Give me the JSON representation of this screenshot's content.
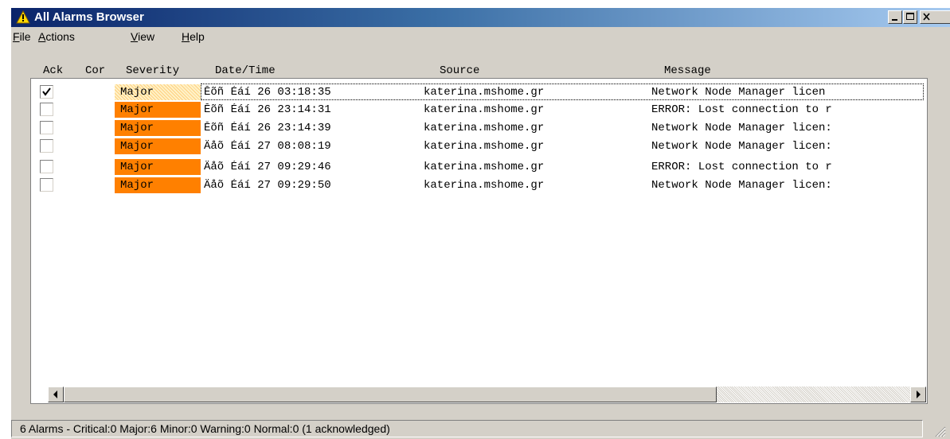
{
  "window": {
    "title": "All Alarms Browser",
    "title_icon": "warning-triangle-icon",
    "controls": [
      "minimize-icon",
      "maximize-icon",
      "close-icon"
    ]
  },
  "menu": {
    "file": {
      "u": "F",
      "rest": "ile"
    },
    "actions": {
      "u": "A",
      "rest": "ctions"
    },
    "view": {
      "u": "V",
      "rest": "iew"
    },
    "help": {
      "u": "H",
      "rest": "elp"
    }
  },
  "table": {
    "headers": {
      "ack": "Ack",
      "cor": "Cor",
      "severity": "Severity",
      "datetime": "Date/Time",
      "source": "Source",
      "message": "Message"
    },
    "rows": [
      {
        "ack": true,
        "severity": "Major",
        "datetime": "Ĕõñ Éáí 26 03:18:35",
        "source": "katerina.mshome.gr",
        "message": "Network Node Manager licen"
      },
      {
        "ack": false,
        "severity": "Major",
        "datetime": "Ĕõñ Éáí 26 23:14:31",
        "source": "katerina.mshome.gr",
        "message": "ERROR: Lost connection to r"
      },
      {
        "ack": false,
        "severity": "Major",
        "datetime": "Ĕõñ Éáí 26 23:14:39",
        "source": "katerina.mshome.gr",
        "message": "Network Node Manager licen:"
      },
      {
        "ack": false,
        "severity": "Major",
        "datetime": "Äåõ Éáí 27 08:08:19",
        "source": "katerina.mshome.gr",
        "message": "Network Node Manager licen:"
      },
      {
        "ack": false,
        "severity": "Major",
        "datetime": "Äåõ Éáí 27 09:29:46",
        "source": "katerina.mshome.gr",
        "message": "ERROR: Lost connection to r"
      },
      {
        "ack": false,
        "severity": "Major",
        "datetime": "Äåõ Éáí 27 09:29:50",
        "source": "katerina.mshome.gr",
        "message": "Network Node Manager licen:"
      }
    ]
  },
  "colors": {
    "major": "#ff8000",
    "titlebar": "#0a246a",
    "face": "#d4d0c8"
  },
  "scrollbar": {
    "left_icon": "arrow-left-icon",
    "right_icon": "arrow-right-icon"
  },
  "status": {
    "text": "6 Alarms - Critical:0 Major:6 Minor:0 Warning:0 Normal:0 (1 acknowledged)"
  }
}
